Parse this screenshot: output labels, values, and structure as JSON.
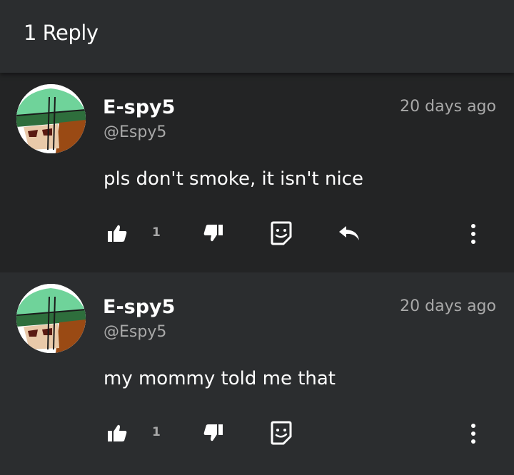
{
  "header": {
    "title": "1 Reply"
  },
  "comments": [
    {
      "author": "E-spy5",
      "handle": "@Espy5",
      "time": "20 days ago",
      "text": "pls don't smoke, it isn't nice",
      "likes": "1",
      "has_reply": true
    },
    {
      "author": "E-spy5",
      "handle": "@Espy5",
      "time": "20 days ago",
      "text": "my mommy told me that",
      "likes": "1",
      "has_reply": false
    }
  ],
  "icons": {
    "like": "thumbs-up-icon",
    "dislike": "thumbs-down-icon",
    "sticker": "sticker-icon",
    "reply": "reply-icon",
    "more": "more-vertical-icon"
  },
  "colors": {
    "header_bg": "#2b2d2f",
    "reply_bg": "#232425",
    "comment_bg": "#2b2d2f",
    "muted_text": "#a9a9a9"
  }
}
